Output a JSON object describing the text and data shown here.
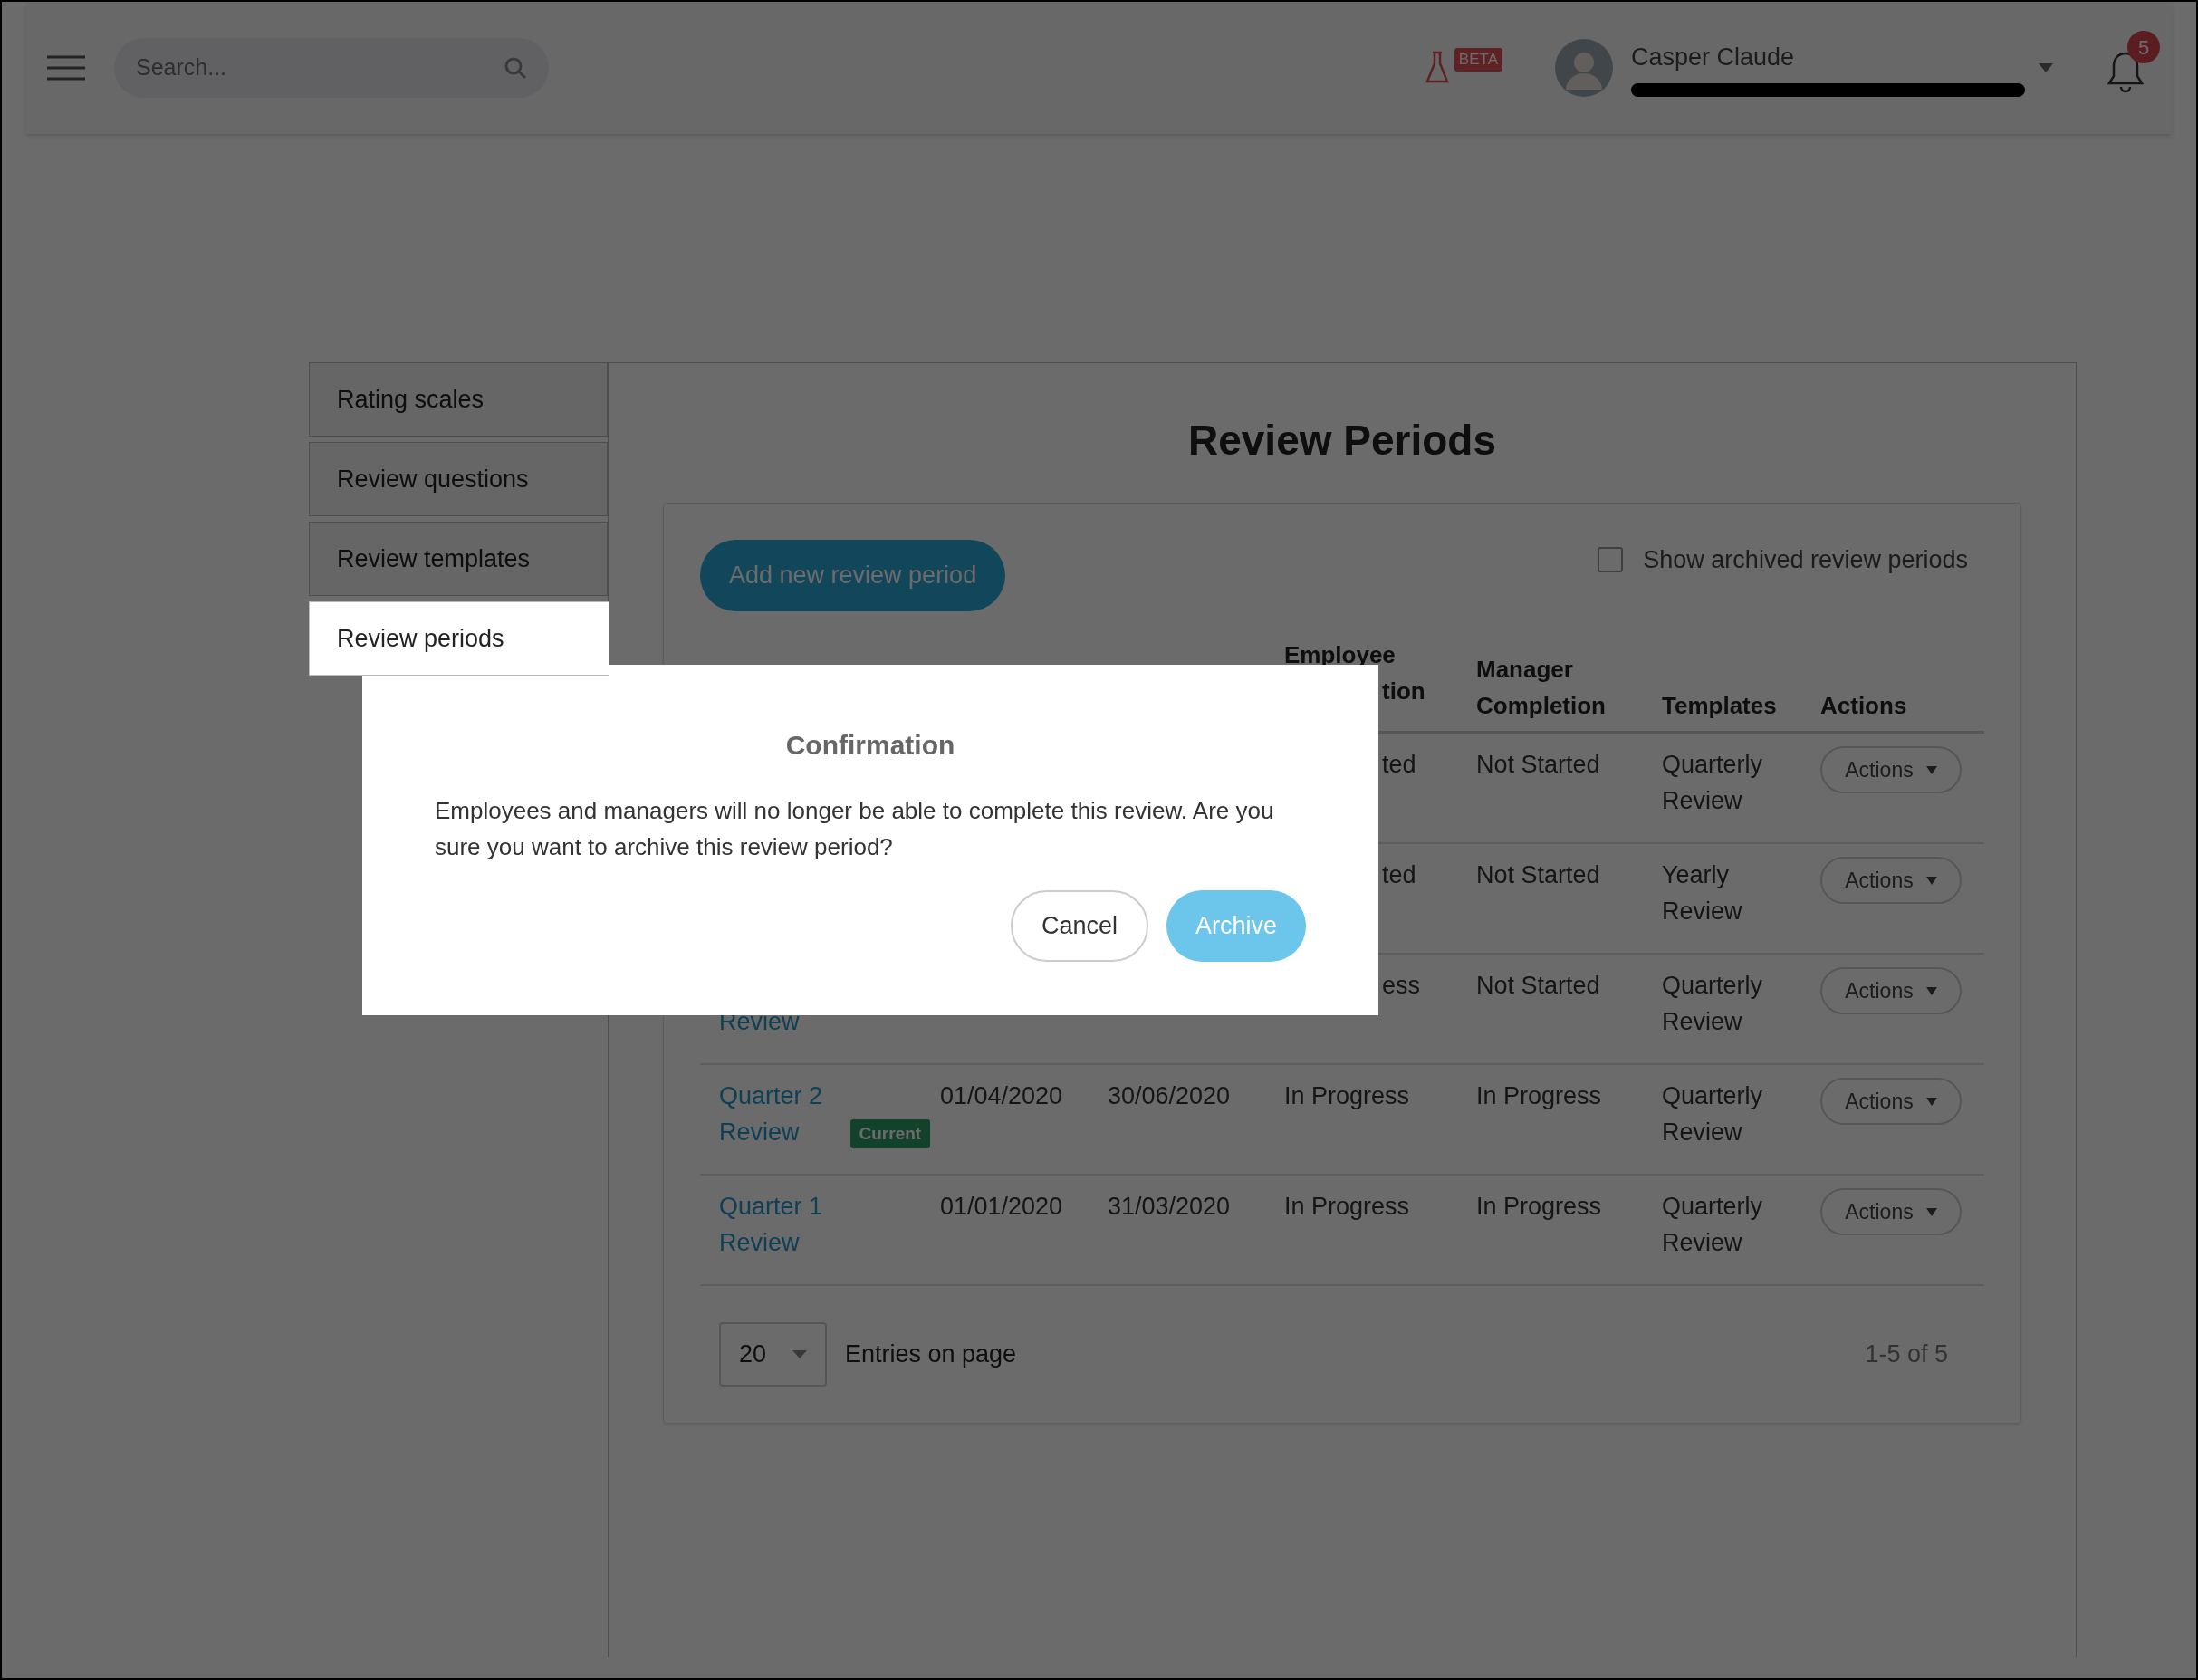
{
  "header": {
    "search": {
      "placeholder": "Search..."
    },
    "beta_badge": "BETA",
    "user": {
      "name": "Casper Claude",
      "email_redacted": true
    },
    "notifications": {
      "count": "5"
    }
  },
  "sidebar": {
    "items": [
      {
        "label": "Rating scales",
        "selected": false
      },
      {
        "label": "Review questions",
        "selected": false
      },
      {
        "label": "Review templates",
        "selected": false
      },
      {
        "label": "Review periods",
        "selected": true
      }
    ]
  },
  "page_title": "Review Periods",
  "add_button": "Add new review period",
  "show_archived": {
    "label": "Show archived review periods",
    "checked": false
  },
  "table": {
    "columns": [
      {
        "label": "Employee",
        "covered_part": "tion"
      },
      {
        "label": "Manager Completion"
      },
      {
        "label": "Templates"
      },
      {
        "label": "Actions"
      }
    ],
    "rows": [
      {
        "employee": "ted",
        "employee_covered": true,
        "manager": "Not Started",
        "template": "Quarterly Review",
        "actions": "Actions"
      },
      {
        "employee": "ted",
        "employee_covered": true,
        "manager": "Not Started",
        "template": "Yearly Review",
        "actions": "Actions"
      },
      {
        "name": "Review",
        "name_covered": true,
        "employee": "ess",
        "employee_covered": true,
        "manager": "Not Started",
        "template": "Quarterly Review",
        "actions": "Actions"
      },
      {
        "name": "Quarter 2 Review",
        "badge": "Current",
        "start": "01/04/2020",
        "end": "30/06/2020",
        "employee": "In Progress",
        "employee_covered": false,
        "manager": "In Progress",
        "template": "Quarterly Review",
        "actions": "Actions"
      },
      {
        "name": "Quarter 1 Review",
        "start": "01/01/2020",
        "end": "31/03/2020",
        "employee": "In Progress",
        "employee_covered": false,
        "manager": "In Progress",
        "template": "Quarterly Review",
        "actions": "Actions"
      }
    ]
  },
  "pagination": {
    "page_size": "20",
    "label": "Entries on page",
    "range": "1-5 of 5"
  },
  "dialog": {
    "title": "Confirmation",
    "message": "Employees and managers will no longer be able to complete this review. Are you sure you want to archive this review period?",
    "buttons": [
      {
        "label": "Cancel",
        "kind": "secondary"
      },
      {
        "label": "Archive",
        "kind": "primary"
      }
    ]
  }
}
